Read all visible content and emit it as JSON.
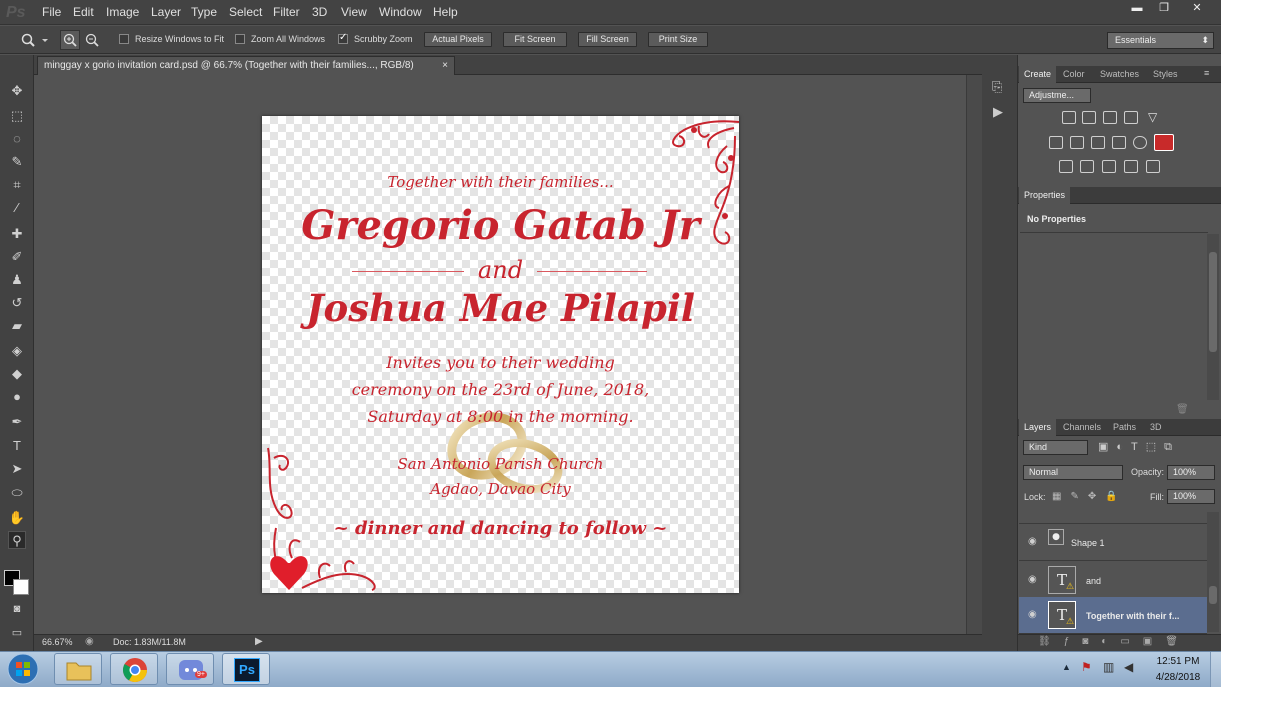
{
  "app": {
    "menu": [
      "File",
      "Edit",
      "Image",
      "Layer",
      "Type",
      "Select",
      "Filter",
      "3D",
      "View",
      "Window",
      "Help"
    ],
    "window_controls": {
      "minimize": "▬",
      "restore": "❐",
      "close": "✕"
    }
  },
  "options_bar": {
    "resize_windows_label": "Resize Windows to Fit",
    "zoom_all_label": "Zoom All Windows",
    "scrubby_zoom_label": "Scrubby Zoom",
    "buttons": [
      "Actual Pixels",
      "Fit Screen",
      "Fill Screen",
      "Print Size"
    ],
    "workspace": "Essentials"
  },
  "document": {
    "tab_title": "minggay x gorio invitation card.psd @ 66.7% (Together with their families..., RGB/8)",
    "tab_close": "×",
    "zoom": "66.67%",
    "doc_size": "Doc: 1.83M/11.8M"
  },
  "invitation": {
    "intro": "Together with their families...",
    "name1": "Gregorio Gatab Jr",
    "conjunction": "and",
    "name2": "Joshua Mae Pilapil",
    "line1": "Invites you to their wedding",
    "line2": "ceremony on the 23rd of June, 2018,",
    "line3": "Saturday at 8:00 in the morning.",
    "venue1": "San Antonio Parish Church",
    "venue2": "Agdao, Davao City",
    "footer": "~ dinner and dancing to follow ~"
  },
  "panels": {
    "top_tabs": [
      "Create",
      "Color",
      "Swatches",
      "Styles"
    ],
    "adjustments_dropdown": "Adjustme...",
    "properties_tab": "Properties",
    "no_properties": "No Properties",
    "layers_tabs": [
      "Layers",
      "Channels",
      "Paths",
      "3D"
    ],
    "kind": "Kind",
    "blend_mode": "Normal",
    "opacity_label": "Opacity:",
    "opacity_value": "100%",
    "lock_label": "Lock:",
    "fill_label": "Fill:",
    "fill_value": "100%",
    "layers": [
      {
        "name": "Shape 1",
        "thumb": "●"
      },
      {
        "name": "and",
        "thumb": "T"
      },
      {
        "name": "Together with their f...",
        "thumb": "T"
      }
    ]
  },
  "taskbar": {
    "time": "12:51 PM",
    "date": "4/28/2018",
    "ps_label": "Ps",
    "discord_badge": "9+"
  },
  "colors": {
    "accent_red": "#c8242e",
    "selected_layer": "#5b6d8f"
  }
}
